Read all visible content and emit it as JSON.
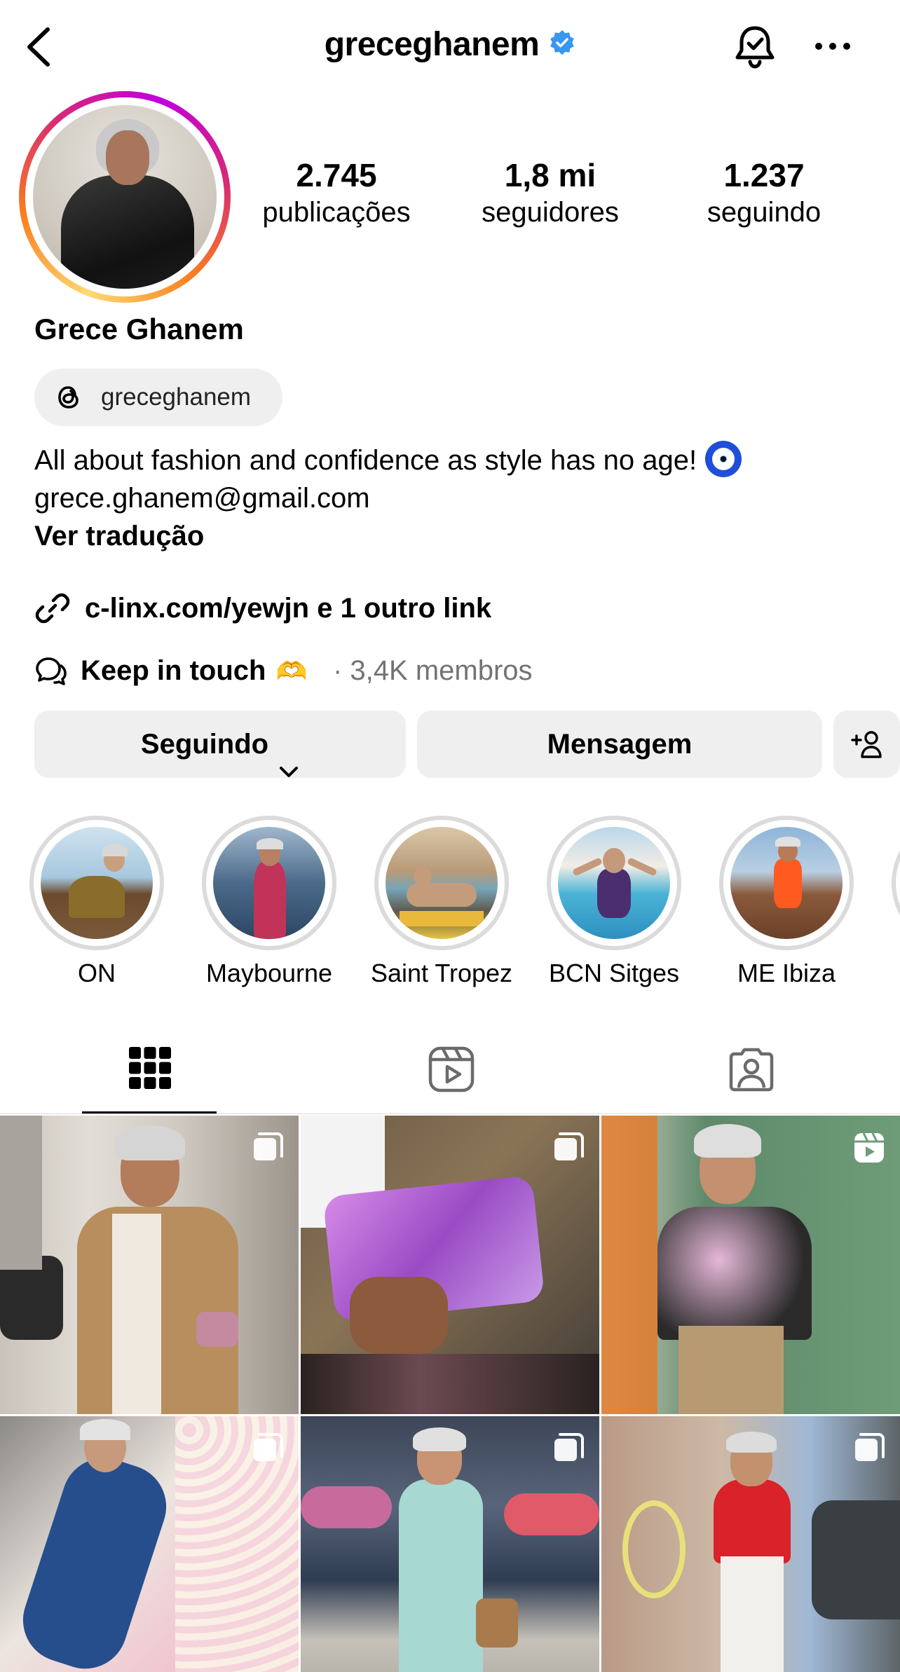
{
  "header": {
    "username": "greceghanem",
    "icons": [
      "back-chevron-icon",
      "verified-badge-icon",
      "notification-bell-icon",
      "more-options-icon"
    ]
  },
  "profile": {
    "display_name": "Grece Ghanem",
    "stats": [
      {
        "value": "2.745",
        "label": "publicações"
      },
      {
        "value": "1,8 mi",
        "label": "seguidores"
      },
      {
        "value": "1.237",
        "label": "seguindo"
      }
    ],
    "threads_handle": "greceghanem",
    "bio_text": "All about fashion and confidence as style has no age!",
    "bio_email": "grece.ghanem@gmail.com",
    "translate_label": "Ver tradução",
    "link_text": "c-linx.com/yewjn e 1 outro link",
    "channel_name": "Keep in touch",
    "channel_meta": "· 3,4K membros"
  },
  "actions": {
    "following_label": "Seguindo",
    "message_label": "Mensagem"
  },
  "highlights": [
    {
      "label": "ON"
    },
    {
      "label": "Maybourne"
    },
    {
      "label": "Saint Tropez"
    },
    {
      "label": "BCN Sitges"
    },
    {
      "label": "ME Ibiza"
    }
  ],
  "tabs": [
    {
      "name": "posts-grid",
      "icon": "grid-icon",
      "active": true
    },
    {
      "name": "reels",
      "icon": "reels-icon",
      "active": false
    },
    {
      "name": "tagged",
      "icon": "tagged-person-icon",
      "active": false
    }
  ],
  "posts": [
    {
      "badge": "carousel-icon"
    },
    {
      "badge": "carousel-icon"
    },
    {
      "badge": "reel-icon"
    },
    {
      "badge": "carousel-icon"
    },
    {
      "badge": "carousel-icon"
    },
    {
      "badge": "carousel-icon"
    }
  ],
  "colors": {
    "verified": "#3897f0",
    "button_bg": "#efefef",
    "muted_text": "#737373",
    "ring_gradient": [
      "#feda75",
      "#fa7e1e",
      "#d62976",
      "#c000e0"
    ]
  }
}
